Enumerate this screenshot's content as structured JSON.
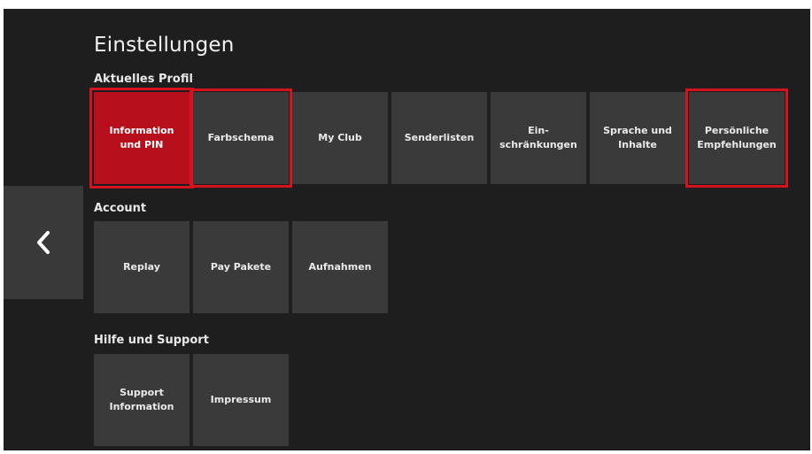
{
  "page": {
    "title": "Einstellungen"
  },
  "sections": {
    "profile": {
      "label": "Aktuelles Profil",
      "tiles": [
        "Information\nund PIN",
        "Farbschema",
        "My Club",
        "Senderlisten",
        "Ein-\nschränkungen",
        "Sprache und\nInhalte",
        "Persönliche\nEmpfehlungen"
      ]
    },
    "account": {
      "label": "Account",
      "tiles": [
        "Replay",
        "Pay Pakete",
        "Aufnahmen"
      ]
    },
    "support": {
      "label": "Hilfe und Support",
      "tiles": [
        "Support\nInformation",
        "Impressum"
      ]
    }
  },
  "icons": {
    "back": "chevron-left-icon"
  },
  "colors": {
    "background": "#1e1e1e",
    "tile": "#3a3a3a",
    "accent": "#b80f1d",
    "highlight_outline": "#d4131f",
    "text": "#eaeaea"
  },
  "state": {
    "selected_tile": "Information und PIN",
    "outlined_tiles": [
      "Information und PIN",
      "Farbschema",
      "Persönliche Empfehlungen"
    ]
  }
}
